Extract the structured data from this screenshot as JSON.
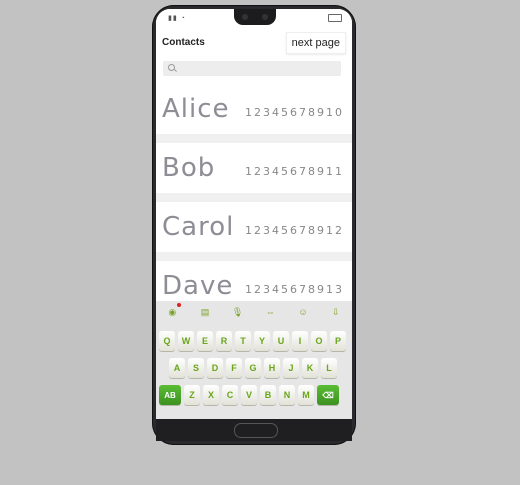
{
  "app": {
    "title": "Contacts",
    "next_label": "next page"
  },
  "search": {
    "placeholder": ""
  },
  "contacts": [
    {
      "name": "Alice",
      "phone": "12345678910"
    },
    {
      "name": "Bob",
      "phone": "12345678911"
    },
    {
      "name": "Carol",
      "phone": "12345678912"
    },
    {
      "name": "Dave",
      "phone": "12345678913"
    }
  ],
  "keyboard": {
    "toolbar": [
      "emoji-keyboard-icon",
      "keyboard-icon",
      "mic-icon",
      "cursor-icon",
      "smiley-icon",
      "collapse-icon"
    ],
    "row1": [
      "Q",
      "W",
      "E",
      "R",
      "T",
      "Y",
      "U",
      "I",
      "O",
      "P"
    ],
    "row2": [
      "A",
      "S",
      "D",
      "F",
      "G",
      "H",
      "J",
      "K",
      "L"
    ],
    "row3": [
      "Z",
      "X",
      "C",
      "V",
      "B",
      "N",
      "M"
    ],
    "mode_label": "AB",
    "delete_icon": "backspace-icon",
    "accent": "#6aa51c"
  }
}
